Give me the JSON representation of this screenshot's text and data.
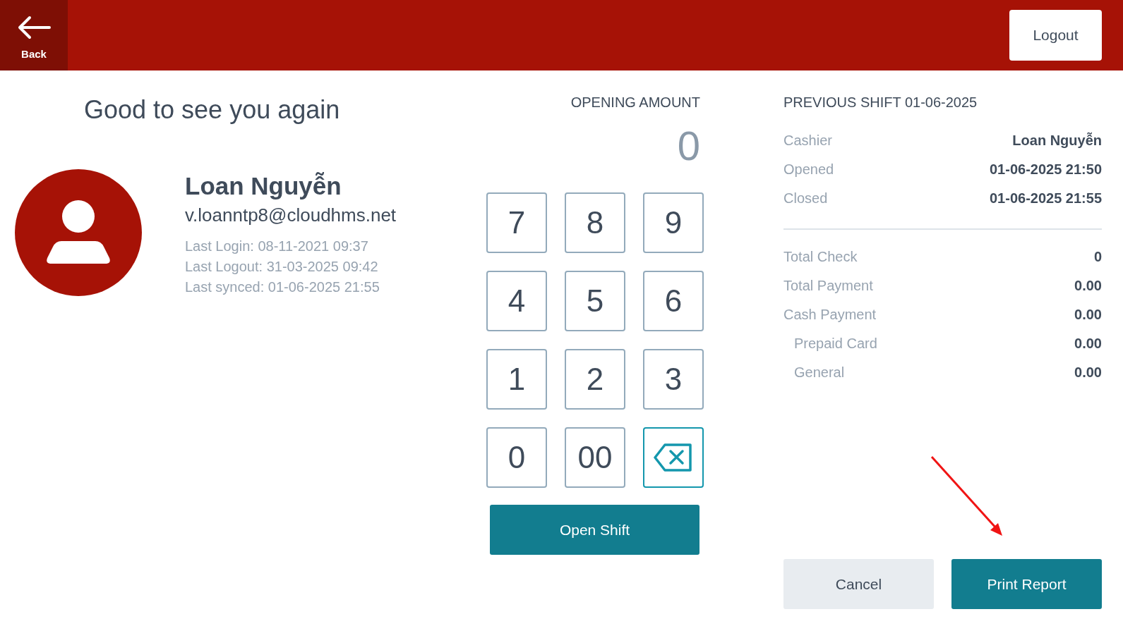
{
  "header": {
    "back_label": "Back",
    "logout_label": "Logout"
  },
  "greeting": "Good to see you again",
  "user": {
    "name": "Loan Nguyễn",
    "email": "v.loanntp8@cloudhms.net",
    "details": [
      "Last Login: 08-11-2021 09:37",
      "Last Logout: 31-03-2025 09:42",
      "Last synced: 01-06-2025 21:55"
    ]
  },
  "opening_amount": {
    "title": "OPENING AMOUNT",
    "value": "0"
  },
  "keypad": [
    {
      "kind": "digit",
      "label": "7"
    },
    {
      "kind": "digit",
      "label": "8"
    },
    {
      "kind": "digit",
      "label": "9"
    },
    {
      "kind": "digit",
      "label": "4"
    },
    {
      "kind": "digit",
      "label": "5"
    },
    {
      "kind": "digit",
      "label": "6"
    },
    {
      "kind": "digit",
      "label": "1"
    },
    {
      "kind": "digit",
      "label": "2"
    },
    {
      "kind": "digit",
      "label": "3"
    },
    {
      "kind": "digit",
      "label": "0"
    },
    {
      "kind": "digit",
      "label": "00"
    },
    {
      "kind": "backspace"
    }
  ],
  "open_shift_label": "Open Shift",
  "previous_shift": {
    "title": "PREVIOUS SHIFT 01-06-2025",
    "info": [
      {
        "label": "Cashier",
        "value": "Loan Nguyễn"
      },
      {
        "label": "Opened",
        "value": "01-06-2025 21:50"
      },
      {
        "label": "Closed",
        "value": "01-06-2025 21:55"
      }
    ],
    "totals": [
      {
        "label": "Total Check",
        "value": "0"
      },
      {
        "label": "Total Payment",
        "value": "0.00"
      },
      {
        "label": "Cash Payment",
        "value": "0.00",
        "children": [
          {
            "label": "Prepaid Card",
            "value": "0.00"
          },
          {
            "label": "General",
            "value": "0.00"
          }
        ]
      }
    ]
  },
  "buttons": [
    {
      "kind": "secondary",
      "label": "Cancel"
    },
    {
      "kind": "primary",
      "label": "Print Report"
    }
  ]
}
